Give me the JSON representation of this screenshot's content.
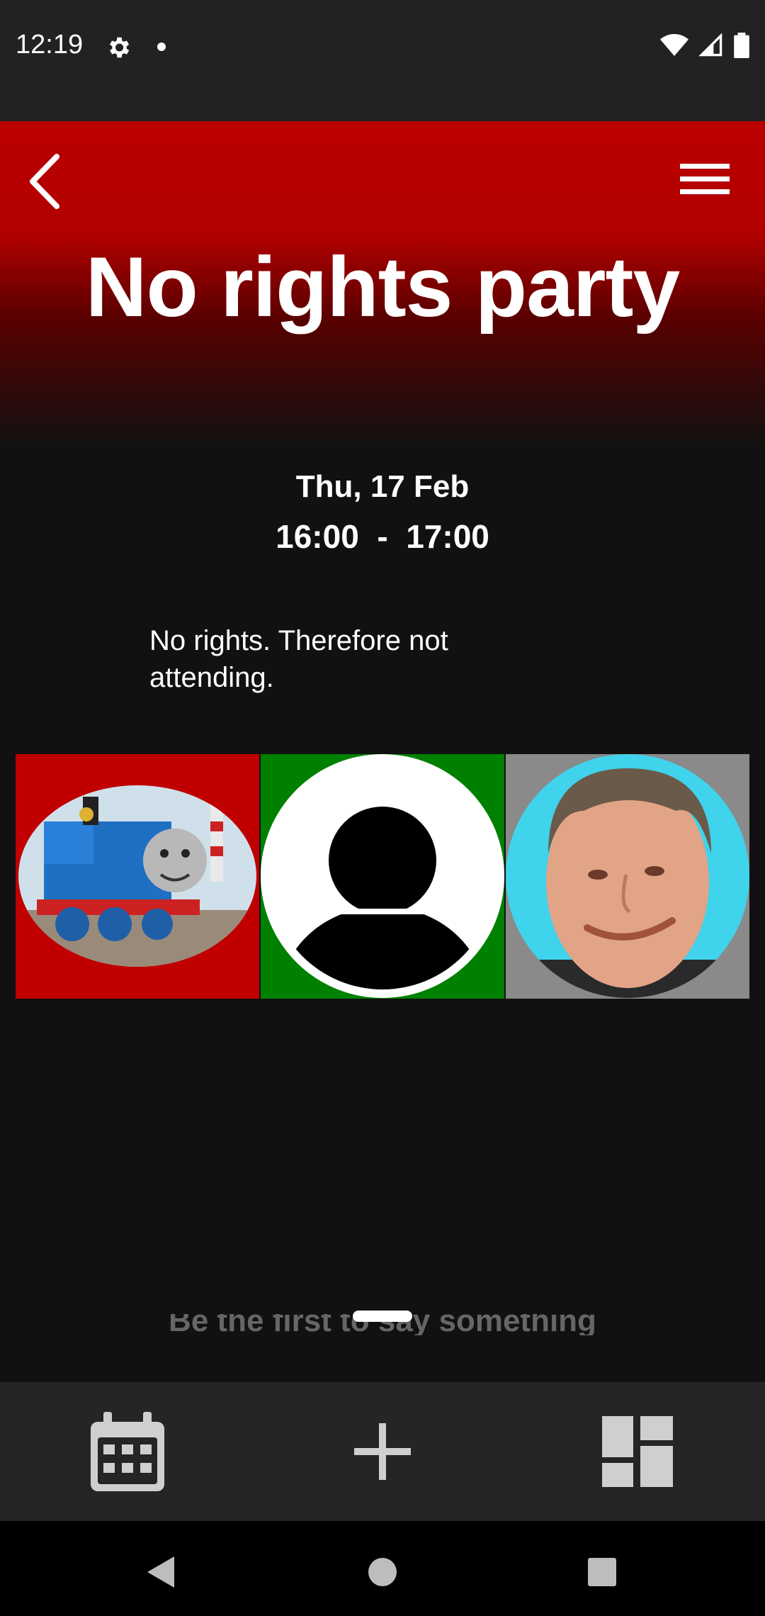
{
  "status_bar": {
    "time": "12:19"
  },
  "event": {
    "title": "No rights party",
    "date": "Thu, 17 Feb",
    "time_range": "16:00  -  17:00",
    "description": "No rights. Therefore not attending."
  },
  "attendees": [
    {
      "name": "thomas-tank-engine",
      "tile_color": "#c00000"
    },
    {
      "name": "default-user",
      "tile_color": "#008000"
    },
    {
      "name": "man-photo",
      "tile_color": "#8a8a8a"
    }
  ],
  "comments": {
    "placeholder": "Be the first to say something"
  },
  "bottom_nav": [
    "calendar-icon",
    "add-icon",
    "dashboard-icon"
  ],
  "colors": {
    "header_red": "#bb0000",
    "background": "#111111",
    "nav_bar": "#252525"
  }
}
